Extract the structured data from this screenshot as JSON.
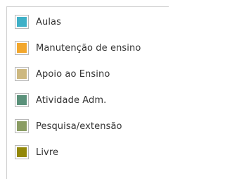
{
  "chart_data": {
    "type": "legend",
    "legend": [
      {
        "label": "Aulas",
        "color": "#3fb0c7"
      },
      {
        "label": "Manutenção de ensino",
        "color": "#f2a72d"
      },
      {
        "label": "Apoio ao Ensino",
        "color": "#cdb880"
      },
      {
        "label": "Atividade Adm.",
        "color": "#5a917a"
      },
      {
        "label": "Pesquisa/extensão",
        "color": "#8a9c63"
      },
      {
        "label": "Livre",
        "color": "#938808"
      }
    ]
  }
}
